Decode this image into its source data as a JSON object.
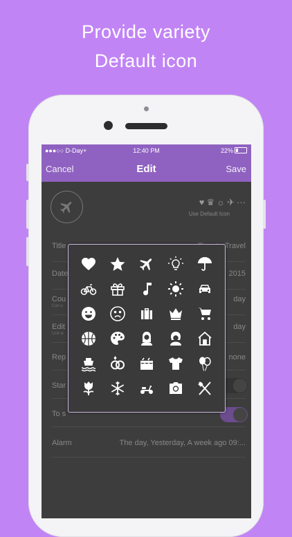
{
  "headline": {
    "line1": "Provide variety",
    "line2": "Default icon"
  },
  "status_bar": {
    "carrier": "●●●○○ D-Day+",
    "time": "12:40 PM",
    "battery": "22%"
  },
  "nav": {
    "cancel": "Cancel",
    "title": "Edit",
    "save": "Save"
  },
  "default_icon_label": "Use Default Icon",
  "form": {
    "title": {
      "label": "Title",
      "value": "Time to Travel"
    },
    "date": {
      "label": "Date",
      "value": "2015"
    },
    "count": {
      "label": "Cou",
      "sub": "Can s",
      "value": "day"
    },
    "edit": {
      "label": "Edit",
      "sub": "Unit w",
      "value": "day"
    },
    "repeat": {
      "label": "Rep",
      "value": "none"
    },
    "start": {
      "label": "Star"
    },
    "to_show": {
      "label": "To s"
    },
    "alarm": {
      "label": "Alarm",
      "value": "The day, Yesterday, A week ago  09:..."
    }
  },
  "icon_grid": [
    [
      "heart",
      "star",
      "airplane",
      "lightbulb",
      "umbrella"
    ],
    [
      "bicycle",
      "gift",
      "music-note",
      "sun",
      "car"
    ],
    [
      "smile",
      "frown",
      "suitcase",
      "crown",
      "cart"
    ],
    [
      "basketball",
      "palette",
      "girl",
      "girl-2",
      "house"
    ],
    [
      "ship",
      "rings",
      "cake",
      "shirt",
      "balloons"
    ],
    [
      "tulip",
      "snowflake",
      "scooter",
      "camera",
      "utensils"
    ]
  ],
  "colors": {
    "background": "#c184f5",
    "header": "#8f62c1",
    "screen": "#3d3d3d",
    "popup": "#3a3a3a",
    "popup_border": "#c9b8e2"
  }
}
